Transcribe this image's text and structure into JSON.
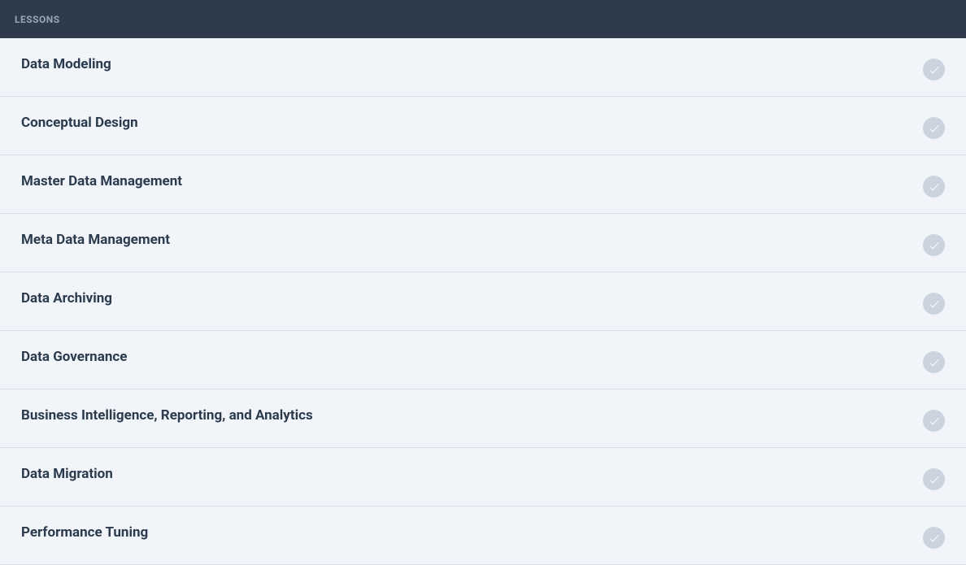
{
  "header": {
    "title": "LESSONS"
  },
  "lessons": [
    {
      "title": "Data Modeling"
    },
    {
      "title": "Conceptual Design"
    },
    {
      "title": "Master Data Management"
    },
    {
      "title": "Meta Data Management"
    },
    {
      "title": "Data Archiving"
    },
    {
      "title": "Data Governance"
    },
    {
      "title": "Business Intelligence, Reporting, and Analytics"
    },
    {
      "title": "Data Migration"
    },
    {
      "title": "Performance Tuning"
    }
  ]
}
